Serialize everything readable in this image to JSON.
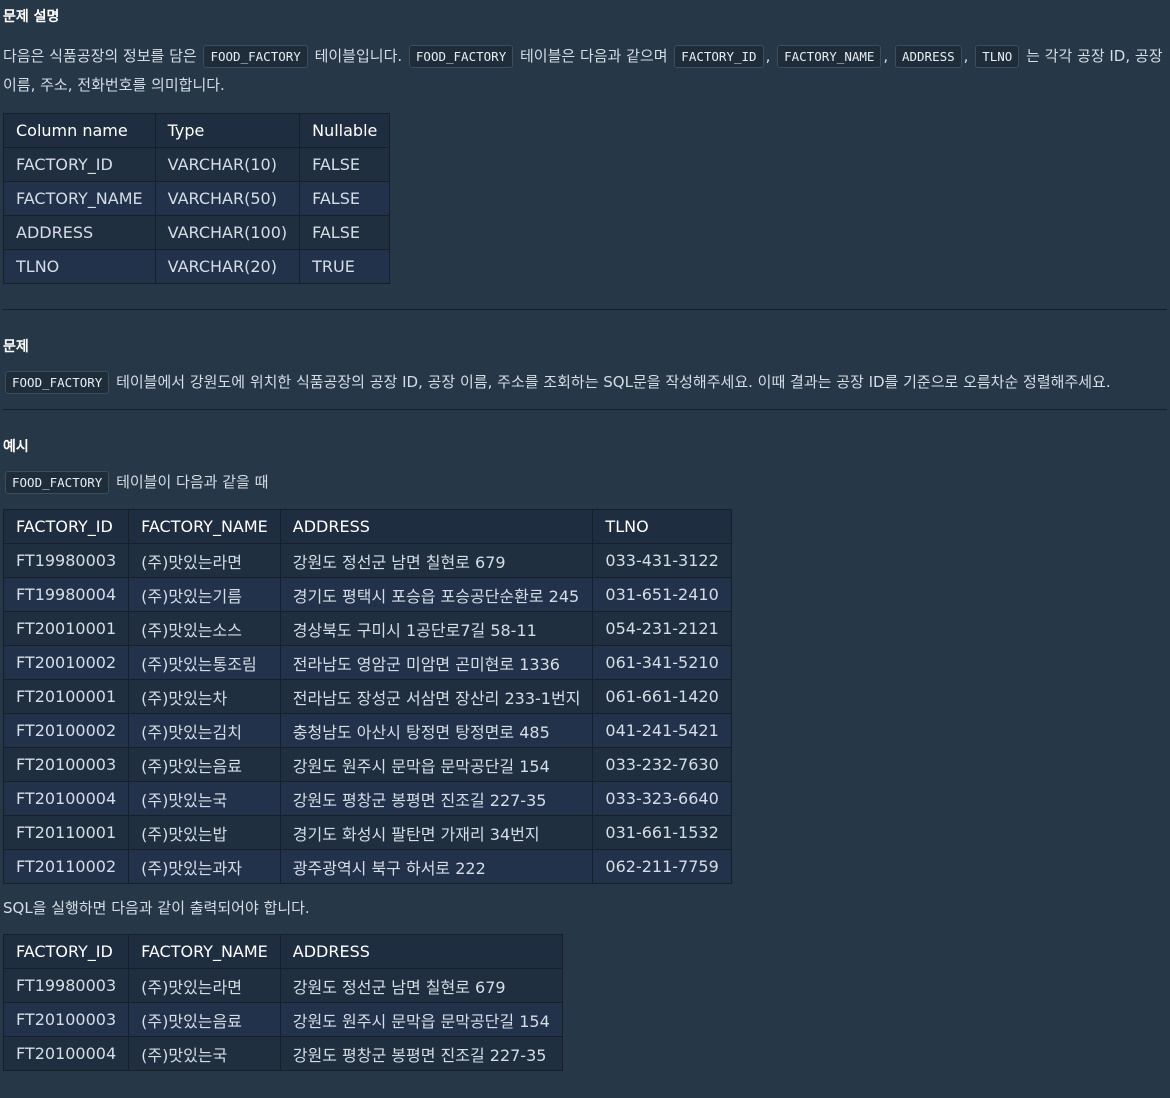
{
  "section1": {
    "title": "문제 설명",
    "desc": [
      {
        "t": "다음은 식품공장의 정보를 담은 "
      },
      {
        "c": "FOOD_FACTORY"
      },
      {
        "t": " 테이블입니다. "
      },
      {
        "c": "FOOD_FACTORY"
      },
      {
        "t": " 테이블은 다음과 같으며 "
      },
      {
        "c": "FACTORY_ID"
      },
      {
        "t": ", "
      },
      {
        "c": "FACTORY_NAME"
      },
      {
        "t": ", "
      },
      {
        "c": "ADDRESS"
      },
      {
        "t": ", "
      },
      {
        "c": "TLNO"
      },
      {
        "t": " 는 각각 공장 ID, 공장 이름, 주소, 전화번호를 의미합니다."
      }
    ]
  },
  "schema_table": {
    "headers": [
      "Column name",
      "Type",
      "Nullable"
    ],
    "rows": [
      [
        "FACTORY_ID",
        "VARCHAR(10)",
        "FALSE"
      ],
      [
        "FACTORY_NAME",
        "VARCHAR(50)",
        "FALSE"
      ],
      [
        "ADDRESS",
        "VARCHAR(100)",
        "FALSE"
      ],
      [
        "TLNO",
        "VARCHAR(20)",
        "TRUE"
      ]
    ]
  },
  "section2": {
    "title": "문제",
    "desc": [
      {
        "c": "FOOD_FACTORY"
      },
      {
        "t": " 테이블에서 강원도에 위치한 식품공장의 공장 ID, 공장 이름, 주소를 조회하는 SQL문을 작성해주세요. 이때 결과는 공장 ID를 기준으로 오름차순 정렬해주세요."
      }
    ]
  },
  "section3": {
    "title": "예시",
    "intro": [
      {
        "c": "FOOD_FACTORY"
      },
      {
        "t": " 테이블이 다음과 같을 때"
      }
    ],
    "result_text": "SQL을 실행하면 다음과 같이 출력되어야 합니다."
  },
  "example_table": {
    "headers": [
      "FACTORY_ID",
      "FACTORY_NAME",
      "ADDRESS",
      "TLNO"
    ],
    "rows": [
      [
        "FT19980003",
        "(주)맛있는라면",
        "강원도 정선군 남면 칠현로 679",
        "033-431-3122"
      ],
      [
        "FT19980004",
        "(주)맛있는기름",
        "경기도 평택시 포승읍 포승공단순환로 245",
        "031-651-2410"
      ],
      [
        "FT20010001",
        "(주)맛있는소스",
        "경상북도 구미시 1공단로7길 58-11",
        "054-231-2121"
      ],
      [
        "FT20010002",
        "(주)맛있는통조림",
        "전라남도 영암군 미암면 곤미현로 1336",
        "061-341-5210"
      ],
      [
        "FT20100001",
        "(주)맛있는차",
        "전라남도 장성군 서삼면 장산리 233-1번지",
        "061-661-1420"
      ],
      [
        "FT20100002",
        "(주)맛있는김치",
        "충청남도 아산시 탕정면 탕정면로 485",
        "041-241-5421"
      ],
      [
        "FT20100003",
        "(주)맛있는음료",
        "강원도 원주시 문막읍 문막공단길 154",
        "033-232-7630"
      ],
      [
        "FT20100004",
        "(주)맛있는국",
        "강원도 평창군 봉평면 진조길 227-35",
        "033-323-6640"
      ],
      [
        "FT20110001",
        "(주)맛있는밥",
        "경기도 화성시 팔탄면 가재리 34번지",
        "031-661-1532"
      ],
      [
        "FT20110002",
        "(주)맛있는과자",
        "광주광역시 북구 하서로 222",
        "062-211-7759"
      ]
    ]
  },
  "result_table": {
    "headers": [
      "FACTORY_ID",
      "FACTORY_NAME",
      "ADDRESS"
    ],
    "rows": [
      [
        "FT19980003",
        "(주)맛있는라면",
        "강원도 정선군 남면 칠현로 679"
      ],
      [
        "FT20100003",
        "(주)맛있는음료",
        "강원도 원주시 문막읍 문막공단길 154"
      ],
      [
        "FT20100004",
        "(주)맛있는국",
        "강원도 평창군 봉평면 진조길 227-35"
      ]
    ]
  }
}
